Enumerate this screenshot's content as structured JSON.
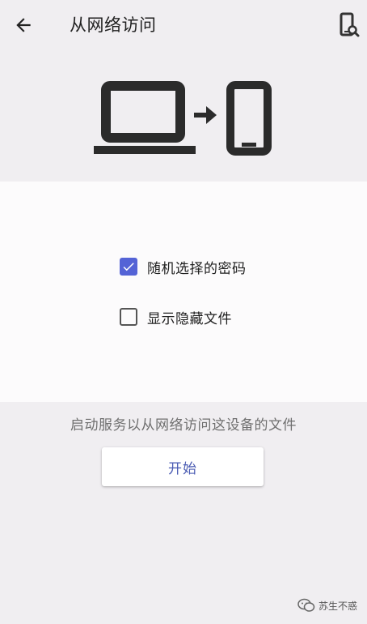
{
  "colors": {
    "accent": "#5463d6",
    "page_background": "#f0eef1",
    "card_background": "#fcfbfc",
    "button_text": "#4a5bb3"
  },
  "appbar": {
    "title": "从网络访问",
    "back_icon": "arrow-left-icon",
    "action_icon": "device-search-icon"
  },
  "hero": {
    "icons": [
      "laptop-icon",
      "arrow-right-icon",
      "phone-icon"
    ]
  },
  "options": [
    {
      "label": "随机选择的密码",
      "checked": true
    },
    {
      "label": "显示隐藏文件",
      "checked": false
    }
  ],
  "footer": {
    "hint": "启动服务以从网络访问这设备的文件",
    "start_label": "开始"
  },
  "watermark": {
    "text": "苏生不惑"
  }
}
